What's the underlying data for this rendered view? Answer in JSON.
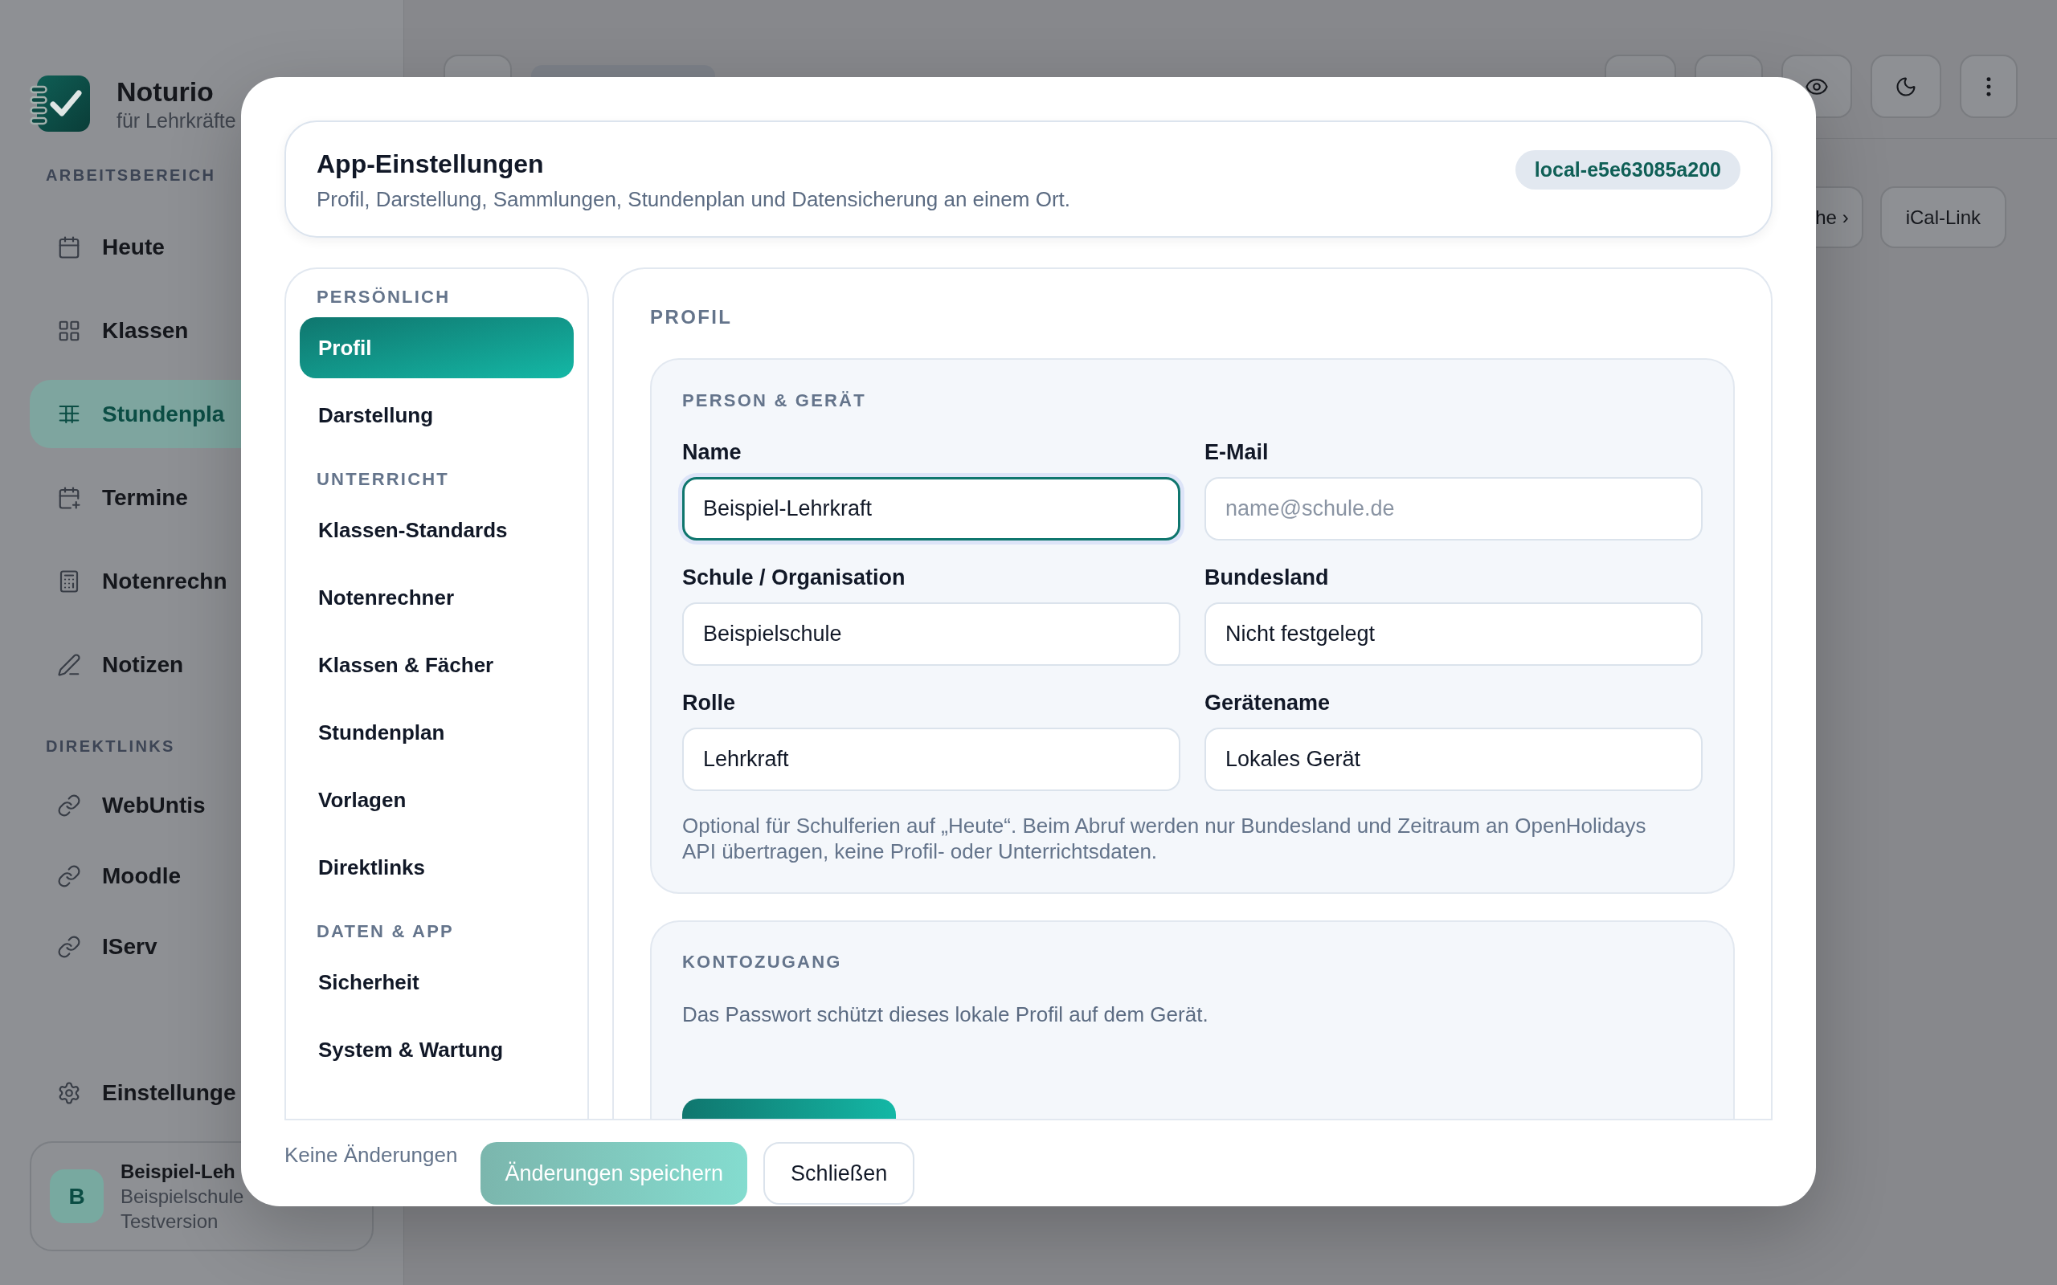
{
  "sidebar": {
    "brand": {
      "name": "Noturio",
      "tagline": "für Lehrkräfte"
    },
    "sections": [
      {
        "title": "ARBEITSBEREICH",
        "kind": "nav",
        "items": [
          {
            "label": "Heute",
            "selected": false
          },
          {
            "label": "Klassen",
            "selected": false
          },
          {
            "label": "Stundenpla",
            "selected": true
          },
          {
            "label": "Termine",
            "selected": false
          },
          {
            "label": "Notenrechn",
            "selected": false
          },
          {
            "label": "Notizen",
            "selected": false
          }
        ]
      },
      {
        "title": "DIREKTLINKS",
        "kind": "links",
        "items": [
          {
            "label": "WebUntis"
          },
          {
            "label": "Moodle"
          },
          {
            "label": "IServ"
          }
        ]
      }
    ],
    "settings": {
      "label": "Einstellunge"
    },
    "user": {
      "initial": "B",
      "name": "Beispiel-Leh",
      "school": "Beispielschule",
      "plan": "Testversion"
    }
  },
  "main": {
    "buttons": [
      {
        "label": "he ›"
      },
      {
        "label": "iCal-Link"
      }
    ]
  },
  "dialog": {
    "title": "App-Einstellungen",
    "subtitle": "Profil, Darstellung, Sammlungen, Stundenplan und Datensicherung an einem Ort.",
    "badge": "local-e5e63085a200",
    "nav": [
      {
        "title": "PERSÖNLICH",
        "items": [
          {
            "label": "Profil",
            "selected": true
          },
          {
            "label": "Darstellung",
            "selected": false
          }
        ]
      },
      {
        "title": "UNTERRICHT",
        "items": [
          {
            "label": "Klassen-Standards",
            "selected": false
          },
          {
            "label": "Notenrechner",
            "selected": false
          },
          {
            "label": "Klassen & Fächer",
            "selected": false
          },
          {
            "label": "Stundenplan",
            "selected": false
          },
          {
            "label": "Vorlagen",
            "selected": false
          },
          {
            "label": "Direktlinks",
            "selected": false
          }
        ]
      },
      {
        "title": "DATEN & APP",
        "items": [
          {
            "label": "Sicherheit",
            "selected": false
          },
          {
            "label": "System & Wartung",
            "selected": false
          }
        ]
      }
    ],
    "content": {
      "heading": "PROFIL",
      "sections": [
        {
          "kind": "form",
          "title": "PERSON & GERÄT",
          "fields": [
            {
              "label": "Name",
              "value": "Beispiel-Lehrkraft",
              "focused": true
            },
            {
              "label": "E-Mail",
              "placeholder": "name@schule.de",
              "focused": false
            },
            {
              "label": "Schule / Organisation",
              "value": "Beispielschule",
              "focused": false
            },
            {
              "label": "Bundesland",
              "value": "Nicht festgelegt",
              "focused": false
            },
            {
              "label": "Rolle",
              "value": "Lehrkraft",
              "focused": false
            },
            {
              "label": "Gerätename",
              "value": "Lokales Gerät",
              "focused": false
            }
          ],
          "note": "Optional für Schulferien auf „Heute“. Beim Abruf werden nur Bundesland und Zeitraum an OpenHolidays API übertragen, keine Profil- oder Unterrichtsdaten."
        },
        {
          "kind": "text",
          "title": "KONTOZUGANG",
          "text": "Das Passwort schützt dieses lokale Profil auf dem Gerät."
        }
      ]
    },
    "footer": {
      "status": "Keine Änderungen",
      "buttons": [
        {
          "label": "Änderungen speichern",
          "kind": "primary",
          "disabled": true
        },
        {
          "label": "Schließen",
          "kind": "secondary",
          "disabled": false
        }
      ]
    }
  }
}
